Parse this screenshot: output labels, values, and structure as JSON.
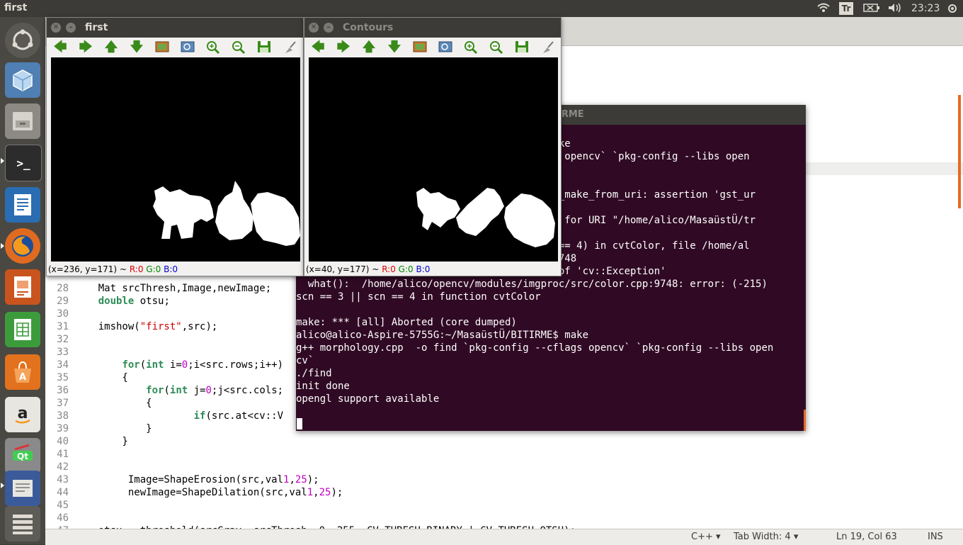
{
  "panel": {
    "title": "first",
    "clock": "23:23",
    "keyboard": "Tr"
  },
  "launcher": {
    "items": [
      "ubuntu-logo",
      "cube-app",
      "files",
      "terminal",
      "writer",
      "firefox",
      "impress",
      "calc",
      "software-center",
      "amazon",
      "qt-creator",
      "gedit",
      "workspaces"
    ]
  },
  "editor": {
    "lines": [
      {
        "n": "28",
        "code": "    Mat srcThresh,Image,newImage;"
      },
      {
        "n": "29",
        "code": "    double otsu;"
      },
      {
        "n": "30",
        "code": ""
      },
      {
        "n": "31",
        "code": "    imshow(\"first\",src);"
      },
      {
        "n": "32",
        "code": ""
      },
      {
        "n": "33",
        "code": ""
      },
      {
        "n": "34",
        "code": "        for(int i=0;i<src.rows;i++)"
      },
      {
        "n": "35",
        "code": "        {"
      },
      {
        "n": "36",
        "code": "            for(int j=0;j<src.cols;"
      },
      {
        "n": "37",
        "code": "            {"
      },
      {
        "n": "38",
        "code": "                    if(src.at<cv::V"
      },
      {
        "n": "39",
        "code": "            }"
      },
      {
        "n": "40",
        "code": "        }"
      },
      {
        "n": "41",
        "code": ""
      },
      {
        "n": "42",
        "code": ""
      },
      {
        "n": "43",
        "code": "         Image=ShapeErosion(src,val1,25);"
      },
      {
        "n": "44",
        "code": "         newImage=ShapeDilation(src,val1,25);"
      },
      {
        "n": "45",
        "code": ""
      },
      {
        "n": "46",
        "code": ""
      },
      {
        "n": "47",
        "code": "    otsu = threshold(srcGray, srcThresh, 0, 255, CV_THRESH_BINARY | CV_THRESH_OTSU);"
      }
    ]
  },
  "status": {
    "language": "C++ ▾",
    "tab_width": "Tab Width: 4 ▾",
    "position": "Ln 19, Col 63",
    "mode": "INS"
  },
  "win_first": {
    "title": "first",
    "coords": "(x=236, y=171) ~",
    "r": "R:0",
    "g": "G:0",
    "b": "B:0"
  },
  "win_contours": {
    "title": "Contours",
    "coords": "(x=40, y=177) ~",
    "r": "R:0",
    "g": "G:0",
    "b": "B:0"
  },
  "terminal": {
    "title": "IRME",
    "lines": [
      "                                      ME$ make",
      "                                      cflags opencv` `pkg-config --libs open",
      "",
      "",
      "                                      lement_make_from_uri: assertion 'gst_ur",
      "",
      "                                      lement for URI \"/home/alico/MasaüstÜ/tr",
      "",
      "                                      | scn == 4) in cvtColor, file /home/al",
      "                                      line 9748",
      "terminate called after throwing an instance of 'cv::Exception'",
      "  what():  /home/alico/opencv/modules/imgproc/src/color.cpp:9748: error: (-215)",
      "scn == 3 || scn == 4 in function cvtColor",
      "",
      "make: *** [all] Aborted (core dumped)",
      "alico@alico-Aspire-5755G:~/MasaüstÜ/BITIRME$ make",
      "g++ morphology.cpp  -o find `pkg-config --cflags opencv` `pkg-config --libs open",
      "cv`",
      "./find",
      "init done",
      "opengl support available"
    ]
  }
}
